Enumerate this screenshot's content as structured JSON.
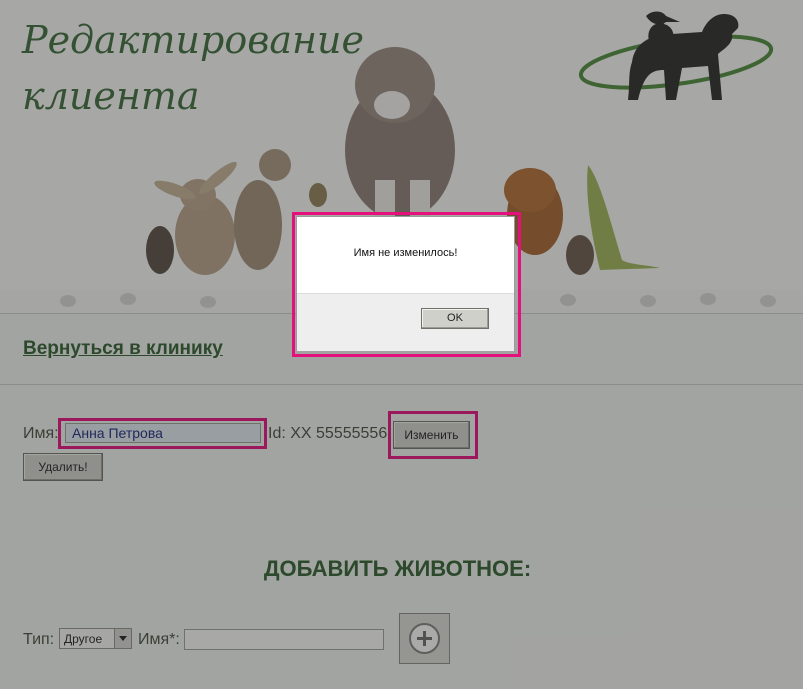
{
  "header": {
    "title_line1": "Редактирование",
    "title_line2": "клиента"
  },
  "nav": {
    "back_link": "Вернуться в клинику"
  },
  "client": {
    "name_label": "Имя:",
    "name_value": "Анна Петрова",
    "id_text": "Id: XX 55555556",
    "edit_button": "Изменить",
    "delete_button": "Удалить!"
  },
  "add_pet": {
    "title": "ДОБАВИТЬ ЖИВОТНОЕ:",
    "type_label": "Тип:",
    "type_selected": "Другое",
    "name_label": "Имя*:",
    "name_value": "",
    "add_icon": "plus-icon"
  },
  "dialog": {
    "message": "Имя не изменилось!",
    "ok_button": "OK"
  },
  "colors": {
    "accent_green": "#2f5e2e",
    "highlight_pink": "#e4107c"
  }
}
